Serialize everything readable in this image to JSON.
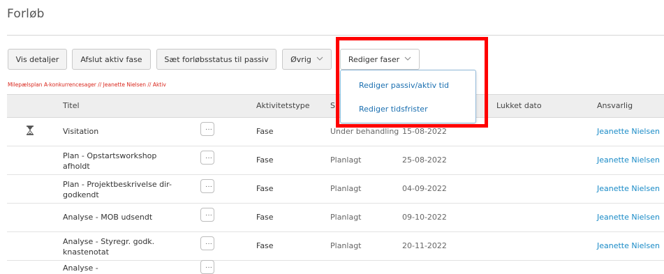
{
  "page": {
    "title": "Forløb"
  },
  "toolbar": {
    "vis_detaljer": "Vis detaljer",
    "afslut_aktiv_fase": "Afslut aktiv fase",
    "saet_status_passiv": "Sæt forløbsstatus til passiv",
    "ovrig": "Øvrig",
    "rediger_faser": "Rediger faser"
  },
  "dropdown": {
    "items": [
      "Rediger passiv/aktiv tid",
      "Rediger tidsfrister"
    ]
  },
  "breadcrumb": "Milepælsplan A-konkurrencesager // Jeanette Nielsen // Aktiv",
  "table": {
    "headers": {
      "titel": "Titel",
      "aktivitetstype": "Aktivitetstype",
      "status": "S",
      "lukket_dato": "Lukket dato",
      "ansvarlig": "Ansvarlig"
    },
    "more_label": "···",
    "rows": [
      {
        "title": "Visitation",
        "type": "Fase",
        "status": "Under behandling",
        "date": "15-08-2022",
        "responsible": "Jeanette Nielsen",
        "active": true
      },
      {
        "title": "Plan - Opstartsworkshop afholdt",
        "type": "Fase",
        "status": "Planlagt",
        "date": "25-08-2022",
        "responsible": "Jeanette Nielsen"
      },
      {
        "title": "Plan - Projektbeskrivelse dir-godkendt",
        "type": "Fase",
        "status": "Planlagt",
        "date": "04-09-2022",
        "responsible": "Jeanette Nielsen"
      },
      {
        "title": "Analyse - MOB udsendt",
        "type": "Fase",
        "status": "Planlagt",
        "date": "09-10-2022",
        "responsible": "Jeanette Nielsen"
      },
      {
        "title": "Analyse - Styregr. godk. knastenotat",
        "type": "Fase",
        "status": "Planlagt",
        "date": "20-11-2022",
        "responsible": "Jeanette Nielsen"
      },
      {
        "title": "Analyse -",
        "type": "",
        "status": "",
        "date": "",
        "responsible": ""
      }
    ]
  },
  "colors": {
    "link": "#1a8bc7",
    "breadcrumb": "#d9261c",
    "highlight": "#ff0000",
    "header_bg": "#eeeeee"
  },
  "icons": {
    "active_row": "hourglass-icon",
    "dropdown_chevron": "chevron-down-icon",
    "row_menu": "more-icon"
  }
}
